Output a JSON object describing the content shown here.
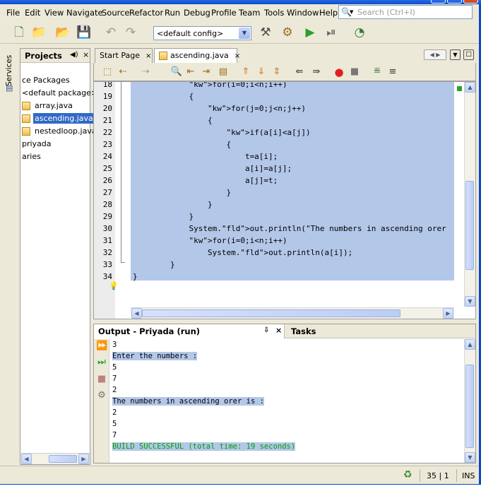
{
  "menu": [
    "File",
    "Edit",
    "View",
    "Navigate",
    "Source",
    "Refactor",
    "Run",
    "Debug",
    "Profile",
    "Team",
    "Tools",
    "Window",
    "Help"
  ],
  "search": {
    "placeholder": "Search (Ctrl+I)"
  },
  "toolbar": {
    "config": "<default config>"
  },
  "left_strip": {
    "services": "Services"
  },
  "projects": {
    "title": "Projects",
    "items": [
      {
        "label": "ce Packages",
        "selected": false,
        "icon": ""
      },
      {
        "label": "<default package>",
        "selected": false,
        "icon": ""
      },
      {
        "label": "array.java",
        "selected": false,
        "icon": "java-file-icon"
      },
      {
        "label": "ascending.java",
        "selected": true,
        "icon": "java-file-icon"
      },
      {
        "label": "nestedloop.java",
        "selected": false,
        "icon": "java-file-icon"
      },
      {
        "label": "priyada",
        "selected": false,
        "icon": ""
      },
      {
        "label": "aries",
        "selected": false,
        "icon": ""
      }
    ]
  },
  "editor_tabs": [
    {
      "label": "Start Page",
      "active": false
    },
    {
      "label": "ascending.java",
      "active": true
    }
  ],
  "editor": {
    "lines": [
      {
        "no": "18",
        "code": "            for(i=0;i<n;i++)"
      },
      {
        "no": "19",
        "code": "            {"
      },
      {
        "no": "20",
        "code": "                for(j=0;j<n;j++)"
      },
      {
        "no": "21",
        "code": "                {"
      },
      {
        "no": "22",
        "code": "                    if(a[i]<a[j])"
      },
      {
        "no": "23",
        "code": "                    {"
      },
      {
        "no": "24",
        "code": "                        t=a[i];"
      },
      {
        "no": "25",
        "code": "                        a[i]=a[j];"
      },
      {
        "no": "26",
        "code": "                        a[j]=t;"
      },
      {
        "no": "27",
        "code": "                    }"
      },
      {
        "no": "28",
        "code": "                }"
      },
      {
        "no": "29",
        "code": "            }"
      },
      {
        "no": "30",
        "code": "            System.out.println(\"The numbers in ascending orer"
      },
      {
        "no": "31",
        "code": "            for(i=0;i<n;i++)"
      },
      {
        "no": "32",
        "code": "                System.out.println(a[i]);"
      },
      {
        "no": "33",
        "code": "        }"
      },
      {
        "no": "34",
        "code": "}"
      }
    ]
  },
  "output": {
    "title": "Output - Priyada (run)",
    "tasks_tab": "Tasks",
    "lines": [
      {
        "text": "3",
        "hl": false,
        "success": false
      },
      {
        "text": "Enter the numbers :",
        "hl": true,
        "success": false
      },
      {
        "text": "5",
        "hl": false,
        "success": false
      },
      {
        "text": "7",
        "hl": false,
        "success": false
      },
      {
        "text": "2",
        "hl": false,
        "success": false
      },
      {
        "text": "The numbers in ascending orer is :",
        "hl": true,
        "success": false
      },
      {
        "text": "2",
        "hl": false,
        "success": false
      },
      {
        "text": "5",
        "hl": false,
        "success": false
      },
      {
        "text": "7",
        "hl": false,
        "success": false
      },
      {
        "text": "BUILD SUCCESSFUL (total time: 19 seconds)",
        "hl": true,
        "success": true
      }
    ]
  },
  "status": {
    "position": "35 | 1",
    "mode": "INS"
  }
}
